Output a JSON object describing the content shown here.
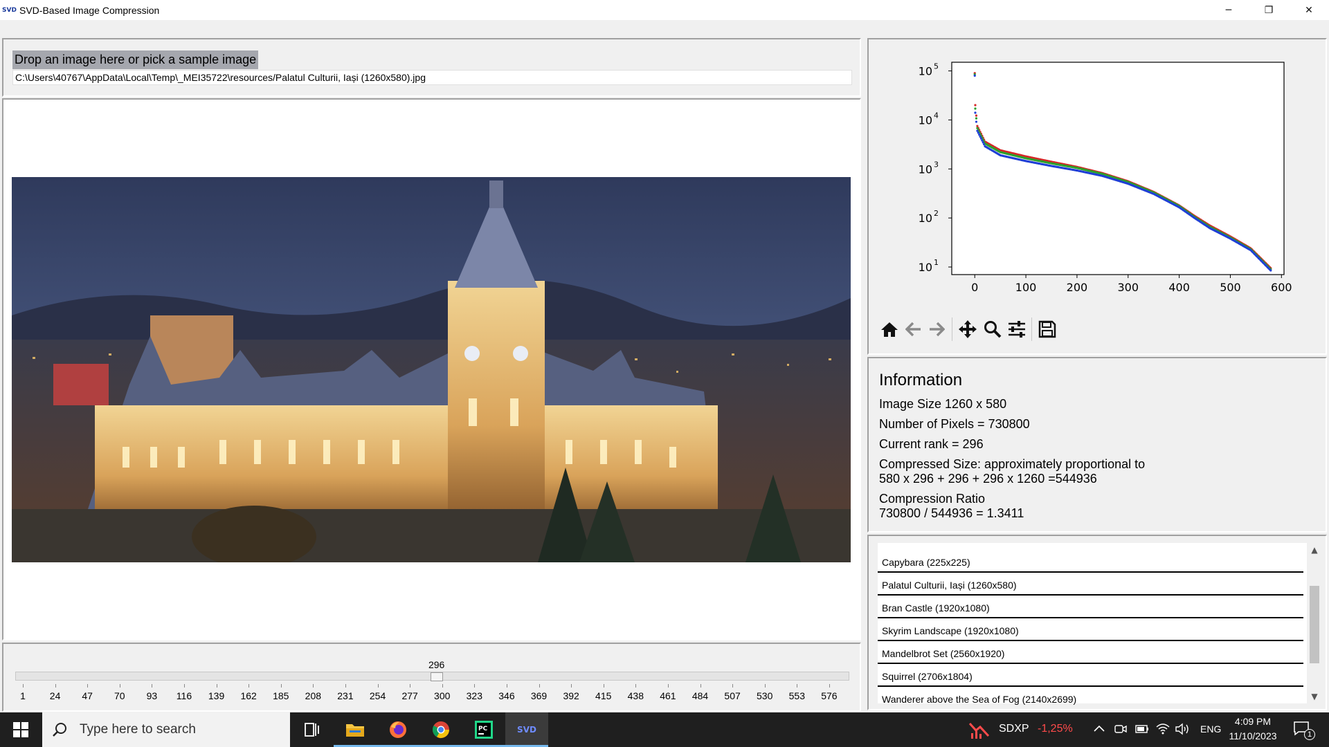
{
  "window": {
    "logo_text": "SVD",
    "title": "SVD-Based Image Compression",
    "minimize": "─",
    "restore": "❐",
    "close": "✕"
  },
  "drop": {
    "label": "Drop an image here or pick a sample image",
    "path": "C:\\Users\\40767\\AppData\\Local\\Temp\\_MEI35722\\resources/Palatul Culturii, Iași (1260x580).jpg"
  },
  "slider": {
    "value": 296,
    "min": 1,
    "max": 580,
    "tick_labels": [
      "1",
      "24",
      "47",
      "70",
      "93",
      "116",
      "139",
      "162",
      "185",
      "208",
      "231",
      "254",
      "277",
      "300",
      "323",
      "346",
      "369",
      "392",
      "415",
      "438",
      "461",
      "484",
      "507",
      "530",
      "553",
      "576"
    ]
  },
  "chart_data": {
    "type": "scatter",
    "title": "",
    "xlabel": "",
    "ylabel": "",
    "xlim": [
      -45,
      605
    ],
    "ylim": [
      7,
      150000
    ],
    "y_scale": "log",
    "x_ticks": [
      "0",
      "100",
      "200",
      "300",
      "400",
      "500",
      "600"
    ],
    "y_ticks": [
      "10^5",
      "10^4",
      "10^3",
      "10^2",
      "10^1"
    ],
    "grid": false,
    "series": [
      {
        "color": "#d62728",
        "x": [
          0,
          1,
          5,
          20,
          50,
          100,
          150,
          200,
          250,
          300,
          350,
          400,
          430,
          460,
          500,
          540,
          579
        ],
        "y": [
          90000,
          20000,
          7500,
          3600,
          2400,
          1800,
          1400,
          1100,
          820,
          560,
          340,
          180,
          110,
          70,
          42,
          24,
          9.5
        ]
      },
      {
        "color": "#2ca02c",
        "x": [
          0,
          1,
          5,
          20,
          50,
          100,
          150,
          200,
          250,
          300,
          350,
          400,
          430,
          460,
          500,
          540,
          579
        ],
        "y": [
          85000,
          17000,
          6800,
          3300,
          2200,
          1650,
          1300,
          1050,
          790,
          540,
          330,
          175,
          105,
          66,
          40,
          23,
          9
        ]
      },
      {
        "color": "#1f3fd6",
        "x": [
          0,
          1,
          5,
          20,
          50,
          100,
          150,
          200,
          250,
          300,
          350,
          400,
          430,
          460,
          500,
          540,
          579
        ],
        "y": [
          80000,
          14000,
          6000,
          2900,
          1900,
          1450,
          1150,
          930,
          720,
          500,
          310,
          165,
          100,
          62,
          38,
          22,
          8.5
        ]
      }
    ]
  },
  "toolbar": {
    "home": "home-icon",
    "back": "arrow-left-icon",
    "forward": "arrow-right-icon",
    "pan": "move-icon",
    "zoom": "magnifier-icon",
    "configure": "sliders-icon",
    "save": "floppy-disk-icon"
  },
  "info": {
    "title": "Information",
    "image_size": "Image Size  1260 x 580",
    "pixels": "Number of Pixels = 730800",
    "rank": "Current rank = 296",
    "compressed_1": "Compressed Size: approximately proportional to",
    "compressed_2": " 580 x 296 + 296 + 296 x 1260 =544936",
    "ratio_1": "Compression Ratio",
    "ratio_2": " 730800 / 544936 = 1.3411"
  },
  "samples": [
    "Capybara (225x225)",
    "Palatul Culturii, Iași (1260x580)",
    "Bran Castle (1920x1080)",
    "Skyrim Landscape (1920x1080)",
    "Mandelbrot Set (2560x1920)",
    "Squirrel (2706x1804)",
    "Wanderer above the Sea of Fog (2140x2699)"
  ],
  "taskbar": {
    "search_placeholder": "Type here to search",
    "svd_label": "SVD",
    "ticker_symbol": "SDXP",
    "ticker_change": "-1,25%",
    "language": "ENG",
    "time": "4:09 PM",
    "date": "11/10/2023",
    "notifications": "1",
    "colors": {
      "ticker_negative": "#ff4b4b",
      "active_underline": "#76b9ed"
    }
  }
}
